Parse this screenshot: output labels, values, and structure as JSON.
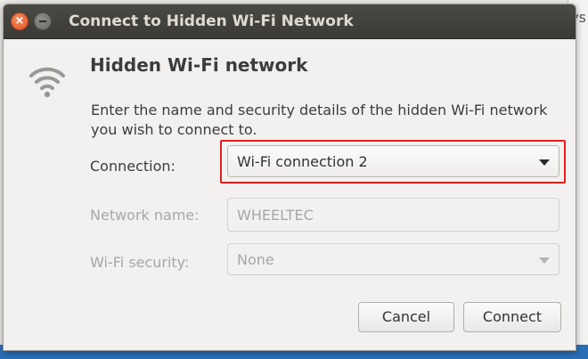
{
  "window": {
    "title": "Connect to Hidden Wi-Fi Network"
  },
  "background": {
    "partial_text": "ys"
  },
  "content": {
    "icon": "wifi-signal-icon",
    "heading": "Hidden Wi-Fi network",
    "description": "Enter the name and security details of the hidden Wi-Fi network you wish to connect to."
  },
  "form": {
    "connection": {
      "label": "Connection:",
      "value": "Wi-Fi connection 2"
    },
    "network_name": {
      "label": "Network name:",
      "value": "WHEELTEC"
    },
    "wifi_security": {
      "label": "Wi-Fi security:",
      "value": "None"
    }
  },
  "buttons": {
    "cancel": "Cancel",
    "connect": "Connect"
  },
  "colors": {
    "titlebar": "#3b3a36",
    "close_button": "#e2542a",
    "highlight_box": "#e0201e",
    "dialog_background": "#f2f1f0"
  }
}
